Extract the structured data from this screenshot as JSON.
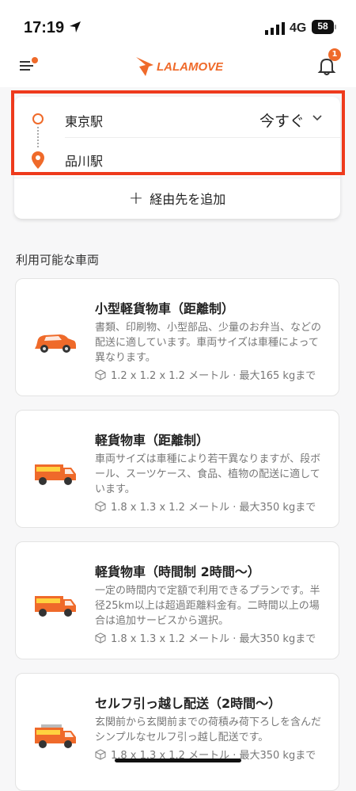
{
  "status": {
    "time": "17:19",
    "network": "4G",
    "battery": "58"
  },
  "app": {
    "logo_text": "LALAMOVE",
    "notification_count": "1"
  },
  "route": {
    "pickup": "東京駅",
    "dropoff": "品川駅",
    "time_label": "今すぐ",
    "add_stop_label": "経由先を追加"
  },
  "section_title": "利用可能な車両",
  "vehicles": [
    {
      "title": "小型軽貨物車（距離制）",
      "desc": "書類、印刷物、小型部品、少量のお弁当、などの配送に適しています。車両サイズは車種によって異なります。",
      "spec": "1.2 x 1.2 x 1.2 メートル · 最大165 kgまで"
    },
    {
      "title": "軽貨物車（距離制）",
      "desc": "車両サイズは車種により若干異なりますが、段ボール、スーツケース、食品、植物の配送に適しています。",
      "spec": "1.8 x 1.3 x 1.2 メートル · 最大350 kgまで"
    },
    {
      "title": "軽貨物車（時間制 2時間〜）",
      "desc": "一定の時間内で定額で利用できるプランです。半径25km以上は超過距離料金有。二時間以上の場合は追加サービスから選択。",
      "spec": "1.8 x 1.3 x 1.2 メートル · 最大350 kgまで"
    },
    {
      "title": "セルフ引っ越し配送（2時間〜）",
      "desc": "玄関前から玄関前までの荷積み荷下ろしを含んだシンプルなセルフ引っ越し配送です。",
      "spec": "1.8 x 1.3 x 1.2 メートル · 最大350 kgまで"
    }
  ],
  "colors": {
    "accent": "#ef6a2a",
    "highlight": "#ee3a1c"
  }
}
